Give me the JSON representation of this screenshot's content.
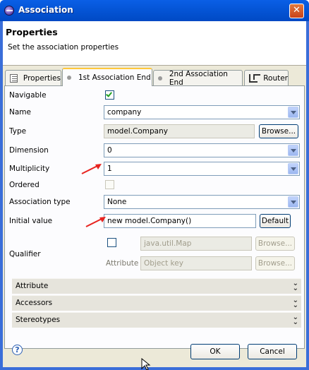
{
  "window": {
    "title": "Association"
  },
  "header": {
    "title": "Properties",
    "description": "Set the association properties"
  },
  "tabs": [
    {
      "label": "Properties",
      "icon": "properties-icon",
      "active": false
    },
    {
      "label": "1st Association End",
      "icon": "dot-icon",
      "active": true
    },
    {
      "label": "2nd Association End",
      "icon": "dot-icon",
      "active": false
    },
    {
      "label": "Router",
      "icon": "router-icon",
      "active": false
    }
  ],
  "form": {
    "navigable": {
      "label": "Navigable",
      "checked": true
    },
    "name": {
      "label": "Name",
      "value": "company"
    },
    "type": {
      "label": "Type",
      "value": "model.Company",
      "button": "Browse..."
    },
    "dimension": {
      "label": "Dimension",
      "value": "0"
    },
    "multiplicity": {
      "label": "Multiplicity",
      "value": "1"
    },
    "ordered": {
      "label": "Ordered",
      "checked": false
    },
    "association_type": {
      "label": "Association type",
      "value": "None"
    },
    "initial_value": {
      "label": "Initial value",
      "value": "new model.Company()",
      "button": "Default"
    },
    "qualifier": {
      "label": "Qualifier",
      "type_value": "java.util.Map",
      "type_button": "Browse...",
      "attribute_label": "Attribute",
      "attribute_value": "Object key",
      "attribute_button": "Browse..."
    }
  },
  "sections": [
    {
      "label": "Attribute"
    },
    {
      "label": "Accessors"
    },
    {
      "label": "Stereotypes"
    }
  ],
  "footer": {
    "ok": "OK",
    "cancel": "Cancel",
    "help": "?"
  },
  "colors": {
    "titlebar": "#0556d8",
    "annotation_arrow": "#e8231f",
    "checkmark": "#21a121"
  }
}
